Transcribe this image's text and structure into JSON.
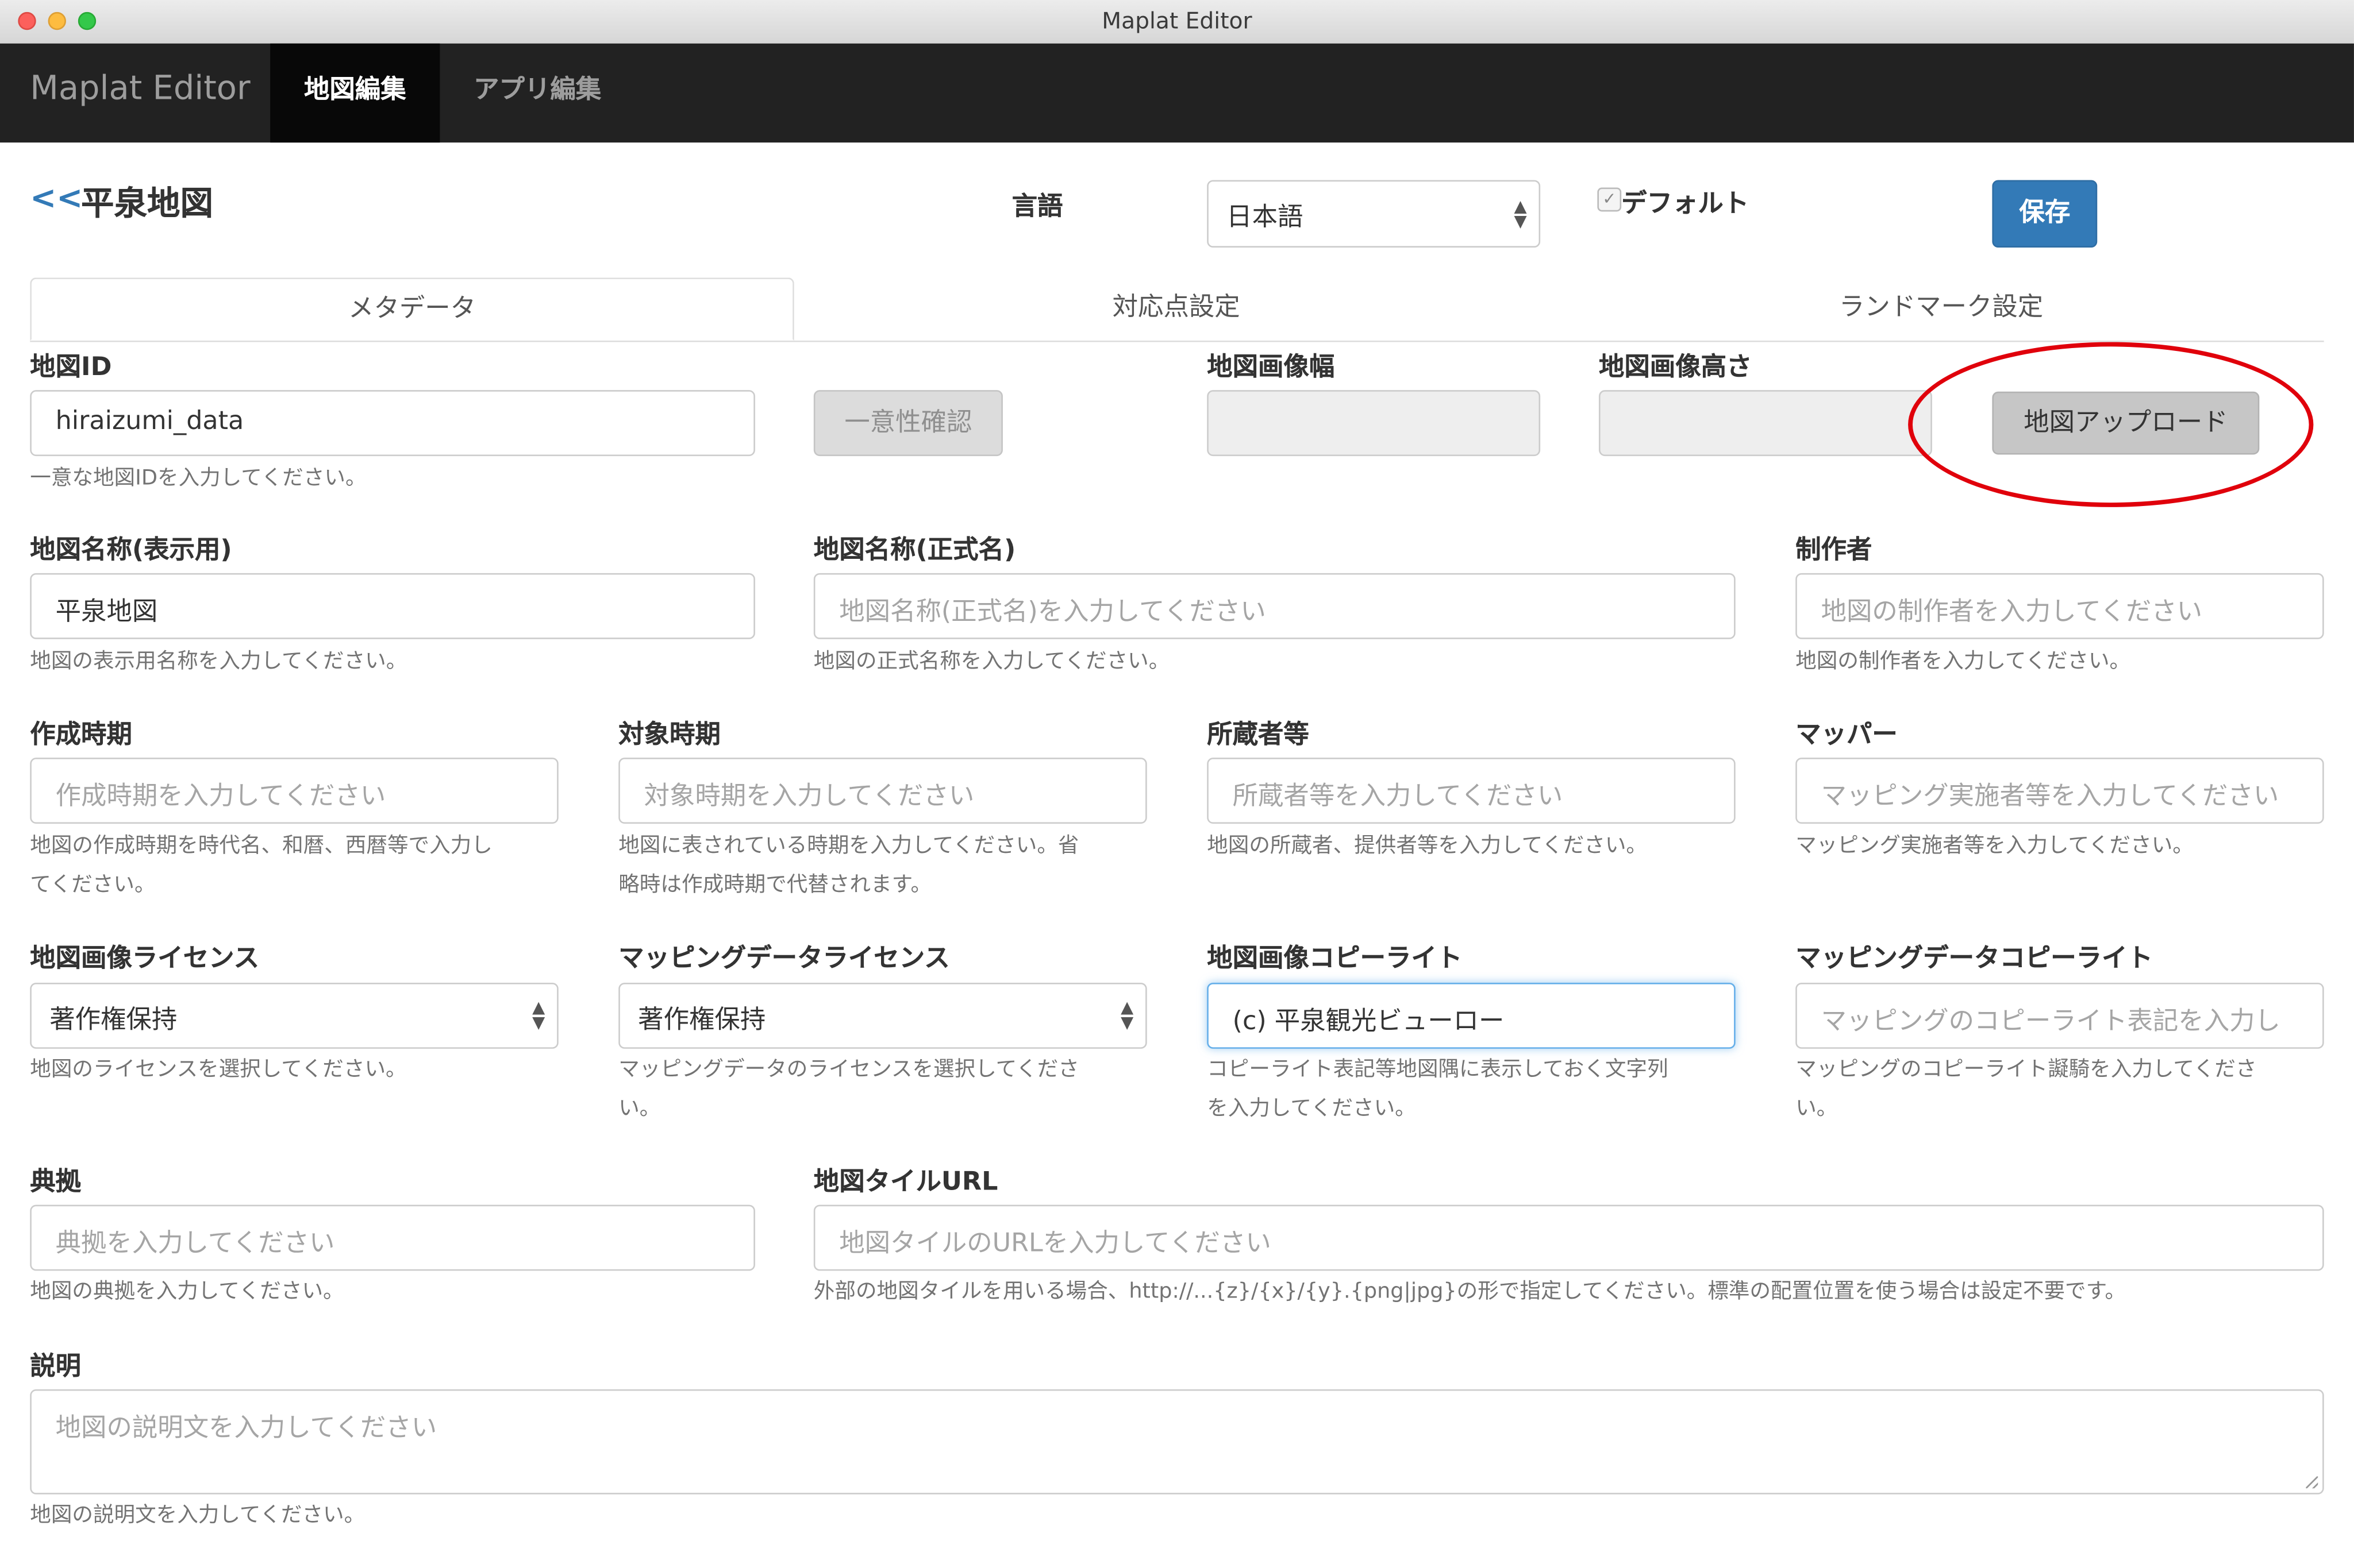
{
  "window": {
    "title": "Maplat Editor"
  },
  "navbar": {
    "brand": "Maplat Editor",
    "tabs": [
      {
        "label": "地図編集",
        "active": true
      },
      {
        "label": "アプリ編集",
        "active": false
      }
    ]
  },
  "header": {
    "back_label": "<<",
    "map_title": "平泉地図",
    "language_label": "言語",
    "language_value": "日本語",
    "default_label": "デフォルト",
    "default_checked": true,
    "save_label": "保存"
  },
  "tabs": [
    {
      "label": "メタデータ",
      "active": true
    },
    {
      "label": "対応点設定",
      "active": false
    },
    {
      "label": "ランドマーク設定",
      "active": false
    }
  ],
  "form": {
    "map_id": {
      "label": "地図ID",
      "value": "hiraizumi_data",
      "help": "一意な地図IDを入力してください。"
    },
    "uniqueness_button": "一意性確認",
    "image_width": {
      "label": "地図画像幅",
      "value": ""
    },
    "image_height": {
      "label": "地図画像高さ",
      "value": ""
    },
    "upload_button": "地図アップロード",
    "display_name": {
      "label": "地図名称(表示用)",
      "value": "平泉地図",
      "help": "地図の表示用名称を入力してください。"
    },
    "official_name": {
      "label": "地図名称(正式名)",
      "placeholder": "地図名称(正式名)を入力してください",
      "help": "地図の正式名称を入力してください。"
    },
    "creator": {
      "label": "制作者",
      "placeholder": "地図の制作者を入力してください",
      "help": "地図の制作者を入力してください。"
    },
    "created_period": {
      "label": "作成時期",
      "placeholder": "作成時期を入力してください",
      "help": [
        "地図の作成時期を時代名、和暦、西暦等で入力し",
        "てください。"
      ]
    },
    "target_period": {
      "label": "対象時期",
      "placeholder": "対象時期を入力してください",
      "help": [
        "地図に表されている時期を入力してください。省",
        "略時は作成時期で代替されます。"
      ]
    },
    "owner": {
      "label": "所蔵者等",
      "placeholder": "所蔵者等を入力してください",
      "help": "地図の所蔵者、提供者等を入力してください。"
    },
    "mapper": {
      "label": "マッパー",
      "placeholder": "マッピング実施者等を入力してください",
      "help": "マッピング実施者等を入力してください。"
    },
    "image_license": {
      "label": "地図画像ライセンス",
      "value": "著作権保持",
      "help": "地図のライセンスを選択してください。"
    },
    "data_license": {
      "label": "マッピングデータライセンス",
      "value": "著作権保持",
      "help": [
        "マッピングデータのライセンスを選択してくださ",
        "い。"
      ]
    },
    "image_copyright": {
      "label": "地図画像コピーライト",
      "value": "(c) 平泉観光ビューロー",
      "help": [
        "コピーライト表記等地図隅に表示しておく文字列",
        "を入力してください。"
      ]
    },
    "data_copyright": {
      "label": "マッピングデータコピーライト",
      "placeholder": "マッピングのコピーライト表記を入力し",
      "help": [
        "マッピングのコピーライト譺騎を入力してくださ",
        "い。"
      ]
    },
    "source": {
      "label": "典拠",
      "placeholder": "典拠を入力してください",
      "help": "地図の典拠を入力してください。"
    },
    "tile_url": {
      "label": "地図タイルURL",
      "placeholder": "地図タイルのURLを入力してください",
      "help": "外部の地図タイルを用いる場合、http://...{z}/{x}/{y}.{png|jpg}の形で指定してください。標準の配置位置を使う場合は設定不要です。"
    },
    "description": {
      "label": "説明",
      "placeholder": "地図の説明文を入力してください",
      "help": "地図の説明文を入力してください。"
    }
  },
  "colors": {
    "navbar_bg": "#222222",
    "primary": "#337ab7",
    "highlight_circle": "#e0000b",
    "traffic_close": "#fc605c",
    "traffic_minimize": "#fdbc40",
    "traffic_zoom": "#34c84a"
  },
  "icons": {
    "select_arrows": "⇕",
    "check": "✓"
  }
}
